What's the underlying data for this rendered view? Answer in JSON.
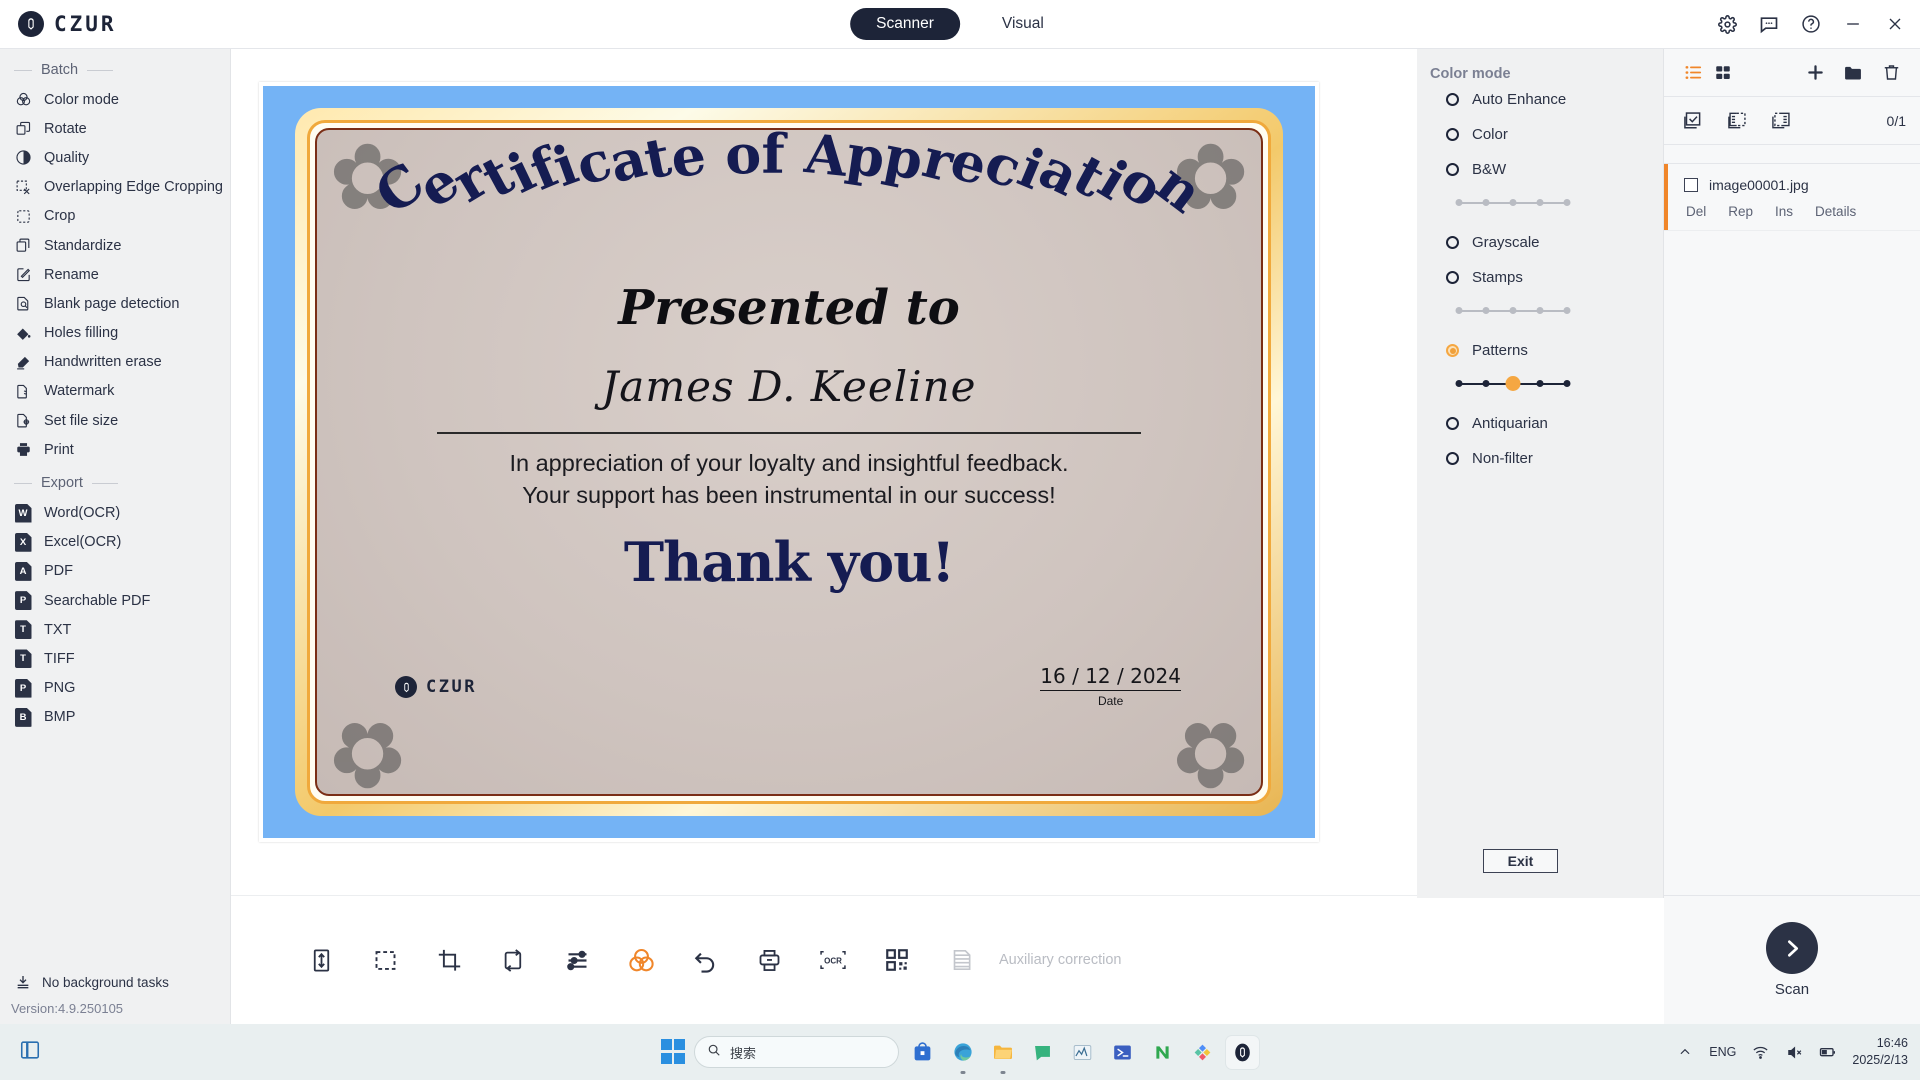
{
  "app": {
    "brand": "CZUR",
    "tabs": [
      {
        "label": "Scanner",
        "active": true
      },
      {
        "label": "Visual",
        "active": false
      }
    ],
    "window_controls": [
      "settings-icon",
      "feedback-icon",
      "help-icon",
      "minimize-icon",
      "close-icon"
    ]
  },
  "sidebar": {
    "sections": [
      {
        "title": "Batch",
        "items": [
          {
            "label": "Color mode",
            "icon": "color-mode-icon"
          },
          {
            "label": "Rotate",
            "icon": "rotate-icon"
          },
          {
            "label": "Quality",
            "icon": "quality-icon"
          },
          {
            "label": "Overlapping Edge Cropping",
            "icon": "overlap-crop-icon"
          },
          {
            "label": "Crop",
            "icon": "crop-icon"
          },
          {
            "label": "Standardize",
            "icon": "standardize-icon"
          },
          {
            "label": "Rename",
            "icon": "rename-icon"
          },
          {
            "label": "Blank page detection",
            "icon": "blank-page-icon"
          },
          {
            "label": "Holes filling",
            "icon": "holes-filling-icon"
          },
          {
            "label": "Handwritten erase",
            "icon": "handwritten-erase-icon"
          },
          {
            "label": "Watermark",
            "icon": "watermark-icon"
          },
          {
            "label": "Set file size",
            "icon": "set-file-size-icon"
          },
          {
            "label": "Print",
            "icon": "print-icon"
          }
        ]
      },
      {
        "title": "Export",
        "items": [
          {
            "label": "Word(OCR)",
            "icon": "word-file-icon",
            "badge": "W"
          },
          {
            "label": "Excel(OCR)",
            "icon": "excel-file-icon",
            "badge": "X"
          },
          {
            "label": "PDF",
            "icon": "pdf-file-icon",
            "badge": "A"
          },
          {
            "label": "Searchable PDF",
            "icon": "searchable-pdf-icon",
            "badge": "P"
          },
          {
            "label": "TXT",
            "icon": "txt-file-icon",
            "badge": "T"
          },
          {
            "label": "TIFF",
            "icon": "tiff-file-icon",
            "badge": "T"
          },
          {
            "label": "PNG",
            "icon": "png-file-icon",
            "badge": "P"
          },
          {
            "label": "BMP",
            "icon": "bmp-file-icon",
            "badge": "B"
          }
        ]
      }
    ],
    "background_tasks": "No background tasks",
    "version": "Version:4.9.250105"
  },
  "certificate": {
    "title": "Certificate of Appreciation",
    "presented_to": "Presented to",
    "recipient": "James D. Keeline",
    "body_line1": "In appreciation of your loyalty and insightful feedback.",
    "body_line2": "Your support has been instrumental in our success!",
    "thanks": "Thank you!",
    "logo": "CZUR",
    "date_value": "16 / 12 / 2024",
    "date_label": "Date",
    "colors": {
      "background": "#74b3f5",
      "paper": "#cfc4bf",
      "ink": "#151c52",
      "gold": "#f0a93c",
      "border": "#7a2e16"
    }
  },
  "toolstrip": {
    "tools": [
      {
        "name": "fit-height-icon",
        "accent": false
      },
      {
        "name": "marquee-select-icon",
        "accent": false
      },
      {
        "name": "crop-frame-icon",
        "accent": false
      },
      {
        "name": "rotate-page-icon",
        "accent": false
      },
      {
        "name": "adjust-sliders-icon",
        "accent": false
      },
      {
        "name": "color-mode-icon",
        "accent": true
      },
      {
        "name": "undo-icon",
        "accent": false
      },
      {
        "name": "print-icon",
        "accent": false
      },
      {
        "name": "ocr-icon",
        "accent": false
      },
      {
        "name": "qr-code-icon",
        "accent": false
      },
      {
        "name": "auxiliary-correction-icon",
        "accent": false
      }
    ],
    "auxiliary_correction_label": "Auxiliary correction"
  },
  "color_mode": {
    "title": "Color mode",
    "options": [
      {
        "label": "Auto Enhance",
        "selected": false
      },
      {
        "label": "Color",
        "selected": false
      },
      {
        "label": "B&W",
        "selected": false
      },
      {
        "label": "Grayscale",
        "selected": false
      },
      {
        "label": "Stamps",
        "selected": false
      },
      {
        "label": "Patterns",
        "selected": true
      },
      {
        "label": "Antiquarian",
        "selected": false
      },
      {
        "label": "Non-filter",
        "selected": false
      }
    ],
    "sliders": [
      {
        "for": "bw",
        "active": false,
        "steps": 5,
        "value_index": 0
      },
      {
        "for": "stamps",
        "active": false,
        "steps": 5,
        "value_index": 0
      },
      {
        "for": "patterns",
        "active": true,
        "steps": 5,
        "value_index": 2
      }
    ],
    "exit_label": "Exit",
    "accent": "#f0a03a"
  },
  "file_panel": {
    "toolbar": [
      "list-view-icon",
      "grid-view-icon",
      "add-icon",
      "folder-icon",
      "delete-icon"
    ],
    "subbar": [
      "select-all-icon",
      "select-odd-icon",
      "select-even-icon"
    ],
    "count": "0/1",
    "files": [
      {
        "name": "image00001.jpg",
        "checked": false,
        "actions": [
          "Del",
          "Rep",
          "Ins",
          "Details"
        ]
      }
    ],
    "scan_label": "Scan"
  },
  "taskbar": {
    "search_placeholder": "搜索",
    "apps": [
      "store-icon",
      "edge-icon",
      "explorer-icon",
      "chat-icon",
      "graph-icon",
      "powershell-icon",
      "n-app-icon",
      "colors-app-icon",
      "czur-app-icon"
    ],
    "language": "ENG",
    "time": "16:46",
    "date": "2025/2/13",
    "tray": [
      "chevron-up-icon",
      "wifi-icon",
      "volume-muted-icon",
      "battery-icon"
    ]
  }
}
